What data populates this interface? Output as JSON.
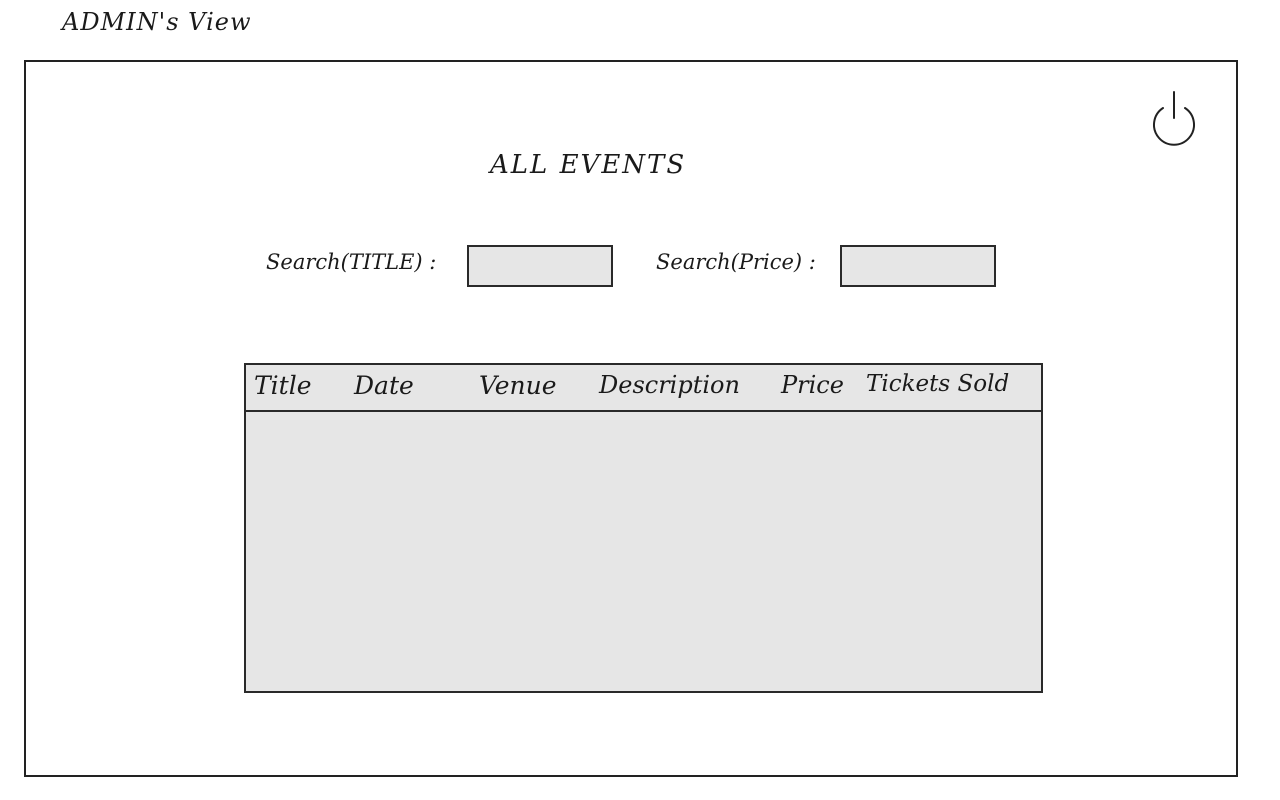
{
  "caption": "ADMIN's View",
  "page": {
    "title": "ALL EVENTS"
  },
  "search": {
    "title_label": "Search(TITLE) :",
    "title_value": "",
    "price_label": "Search(Price) :",
    "price_value": ""
  },
  "header": {
    "power_icon": "power-icon"
  },
  "table": {
    "columns": [
      "Title",
      "Date",
      "Venue",
      "Description",
      "Price",
      "Tickets Sold"
    ],
    "rows": []
  },
  "colors": {
    "field_fill": "#e6e6e6",
    "stroke": "#2a2a2a"
  }
}
